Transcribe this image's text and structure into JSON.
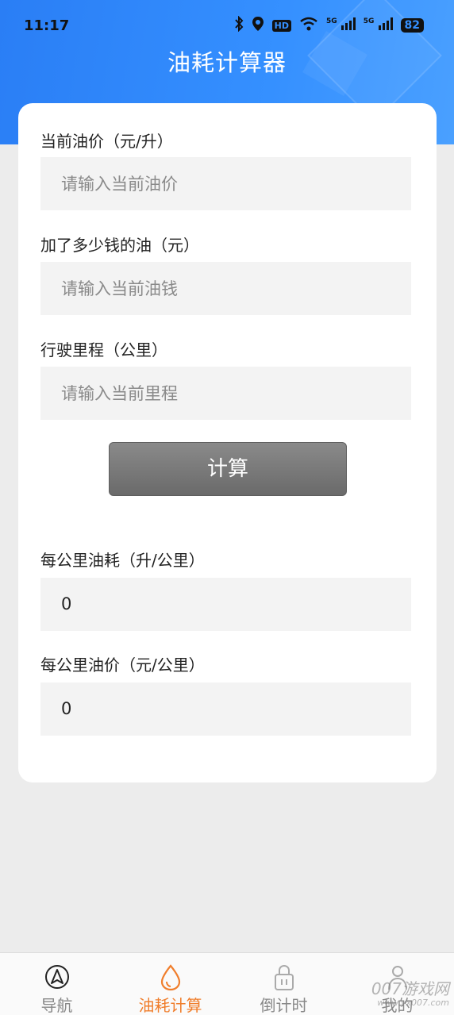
{
  "status_bar": {
    "time": "11:17",
    "hd_label": "HD",
    "signal1_label": "5G",
    "signal2_label": "5G",
    "battery": "82"
  },
  "header": {
    "title": "油耗计算器"
  },
  "form": {
    "price_label": "当前油价（元/升）",
    "price_placeholder": "请输入当前油价",
    "money_label": "加了多少钱的油（元）",
    "money_placeholder": "请输入当前油钱",
    "distance_label": "行驶里程（公里）",
    "distance_placeholder": "请输入当前里程",
    "calc_button": "计算"
  },
  "results": {
    "consumption_label": "每公里油耗（升/公里）",
    "consumption_value": "0",
    "cost_label": "每公里油价（元/公里）",
    "cost_value": "0"
  },
  "tabbar": {
    "tabs": [
      {
        "label": "导航",
        "icon": "navigation-icon",
        "active": false
      },
      {
        "label": "油耗计算",
        "icon": "fuel-drop-icon",
        "active": true
      },
      {
        "label": "倒计时",
        "icon": "lock-icon",
        "active": false
      },
      {
        "label": "我的",
        "icon": "person-icon",
        "active": false
      }
    ]
  },
  "watermark": {
    "line1": "007游戏网",
    "line2": "www.yx007.com"
  },
  "colors": {
    "accent": "#3590ff",
    "active_tab": "#f07e2c",
    "button": "#777777"
  }
}
